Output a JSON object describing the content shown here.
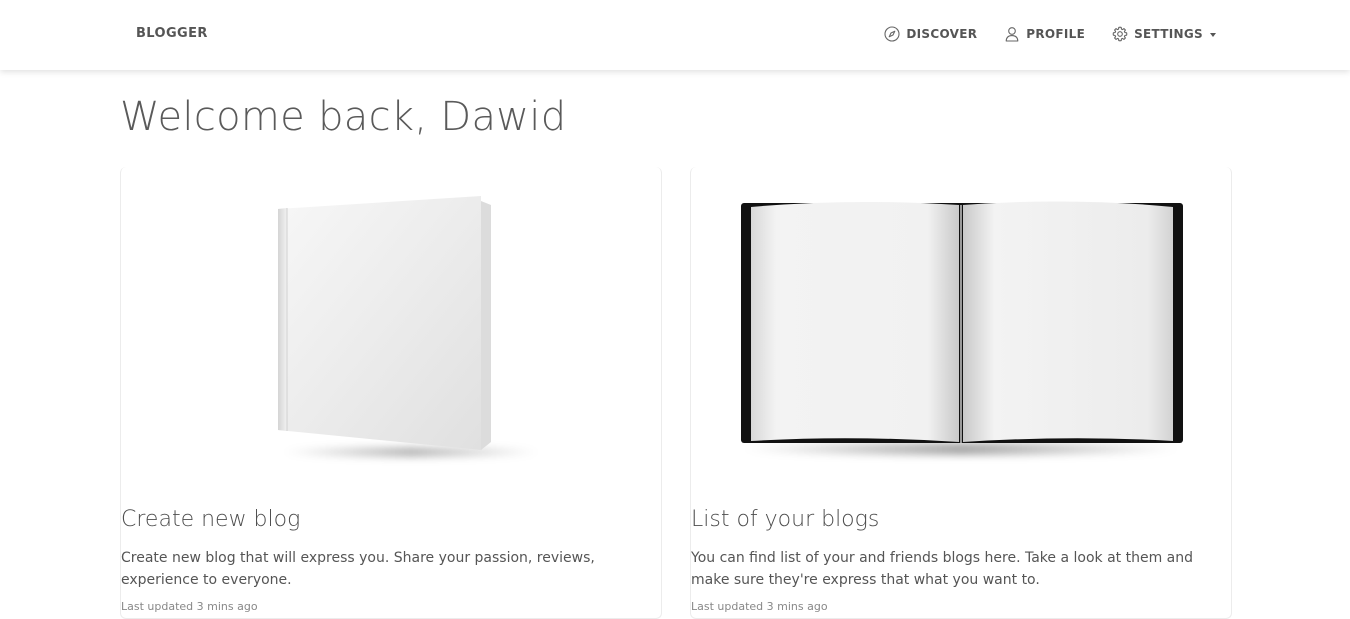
{
  "navbar": {
    "brand": "BLOGGER",
    "links": [
      {
        "label": "DISCOVER",
        "icon": "compass-icon"
      },
      {
        "label": "PROFILE",
        "icon": "user-icon"
      },
      {
        "label": "SETTINGS",
        "icon": "gear-icon"
      }
    ]
  },
  "main": {
    "welcome": "Welcome back, Dawid",
    "cards": [
      {
        "image": "closed-book",
        "title": "Create new blog",
        "text": "Create new blog that will express you. Share your passion, reviews, experience to everyone.",
        "meta": "Last updated 3 mins ago"
      },
      {
        "image": "open-book",
        "title": "List of your blogs",
        "text": "You can find list of your and friends blogs here. Take a look at them and make sure they're express that what you want to.",
        "meta": "Last updated 3 mins ago"
      }
    ]
  }
}
